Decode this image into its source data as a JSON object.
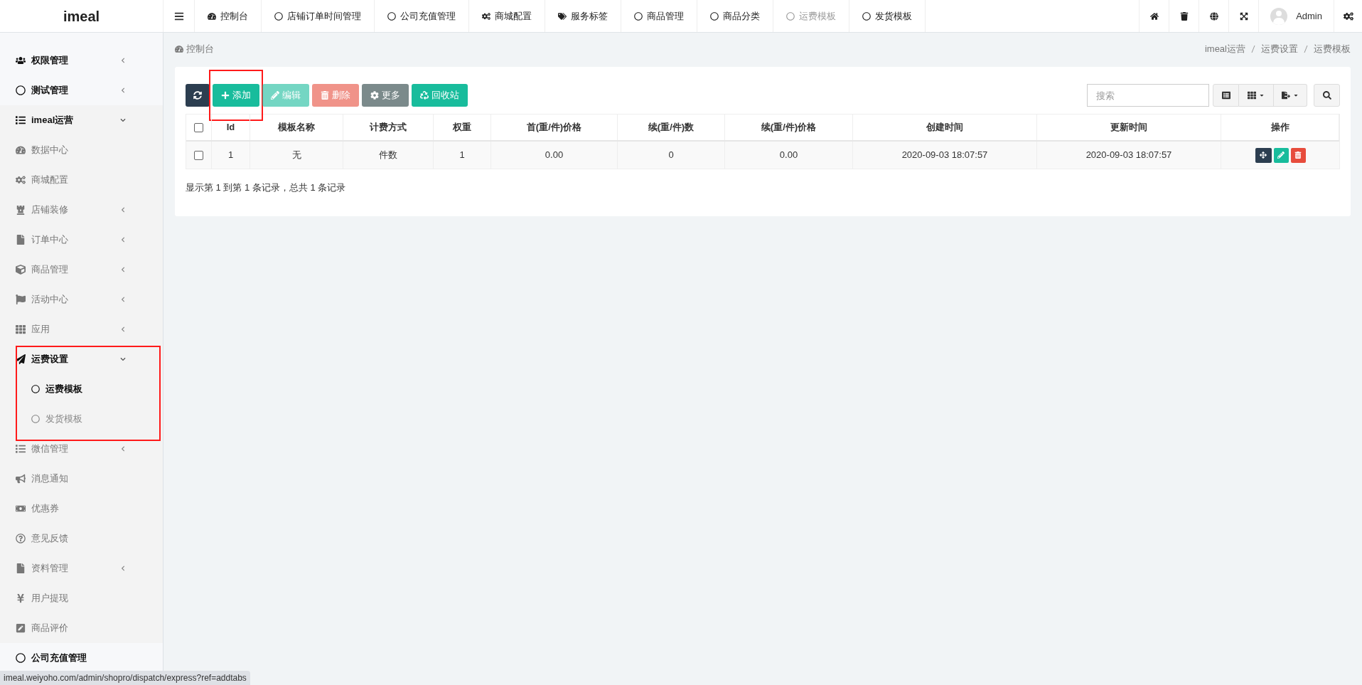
{
  "logo": "imeal",
  "nav_tabs": [
    {
      "label": "控制台",
      "selected": false
    },
    {
      "label": "店铺订单时间管理",
      "selected": false
    },
    {
      "label": "公司充值管理",
      "selected": false
    },
    {
      "label": "商城配置",
      "selected": false
    },
    {
      "label": "服务标签",
      "selected": false
    },
    {
      "label": "商品管理",
      "selected": false
    },
    {
      "label": "商品分类",
      "selected": false
    },
    {
      "label": "运费模板",
      "selected": true
    },
    {
      "label": "发货模板",
      "selected": false
    }
  ],
  "user": {
    "name": "Admin"
  },
  "sidebar": {
    "items": [
      {
        "label": "权限管理",
        "expanded": false,
        "highlighted": false
      },
      {
        "label": "测试管理",
        "expanded": false,
        "highlighted": false
      },
      {
        "label": "imeal运营",
        "expanded": true,
        "highlighted": false,
        "children": [
          {
            "label": "数据中心",
            "highlighted": false
          },
          {
            "label": "商城配置",
            "highlighted": false
          },
          {
            "label": "店铺装修",
            "expanded": false,
            "highlighted": false
          },
          {
            "label": "订单中心",
            "expanded": false,
            "highlighted": false
          },
          {
            "label": "商品管理",
            "expanded": false,
            "highlighted": false
          },
          {
            "label": "活动中心",
            "expanded": false,
            "highlighted": false
          },
          {
            "label": "应用",
            "expanded": false,
            "highlighted": false
          },
          {
            "label": "运费设置",
            "expanded": true,
            "highlighted": true,
            "children": [
              {
                "label": "运费模板",
                "selected": true
              },
              {
                "label": "发货模板",
                "selected": false
              }
            ]
          },
          {
            "label": "微信管理",
            "expanded": false,
            "highlighted": false
          },
          {
            "label": "消息通知",
            "highlighted": false
          },
          {
            "label": "优惠券",
            "highlighted": false
          },
          {
            "label": "意见反馈",
            "highlighted": false
          },
          {
            "label": "资料管理",
            "expanded": false,
            "highlighted": false
          },
          {
            "label": "用户提现",
            "highlighted": false
          },
          {
            "label": "商品评价",
            "highlighted": false
          }
        ]
      },
      {
        "label": "公司充值管理",
        "highlighted": false
      }
    ]
  },
  "page_title": "控制台",
  "breadcrumb": [
    "imeal运营",
    "运费设置",
    "运费模板"
  ],
  "toolbar": {
    "buttons": [
      {
        "disabled": false,
        "highlighted": false
      },
      {
        "label": "添加",
        "disabled": false,
        "highlighted": true
      },
      {
        "label": "编辑",
        "disabled": true,
        "highlighted": false
      },
      {
        "label": "删除",
        "disabled": true,
        "highlighted": false
      },
      {
        "label": "更多",
        "disabled": false,
        "highlighted": false
      },
      {
        "label": "回收站",
        "disabled": false,
        "highlighted": false
      }
    ],
    "search": {
      "placeholder": "搜索"
    }
  },
  "table": {
    "columns": [
      "Id",
      "模板名称",
      "计费方式",
      "权重",
      "首(重/件)价格",
      "续(重/件)数",
      "续(重/件)价格",
      "创建时间",
      "更新时间",
      "操作"
    ],
    "rows": [
      {
        "checked": false,
        "cells": [
          "1",
          "无",
          "件数",
          "1",
          "0.00",
          "0",
          "0.00",
          "2020-09-03 18:07:57",
          "2020-09-03 18:07:57"
        ]
      }
    ],
    "header_checked": false
  },
  "pagination_info": "显示第 1 到第 1 条记录，总共 1 条记录",
  "status_bar": "imeal.weiyoho.com/admin/shopro/dispatch/express?ref=addtabs"
}
